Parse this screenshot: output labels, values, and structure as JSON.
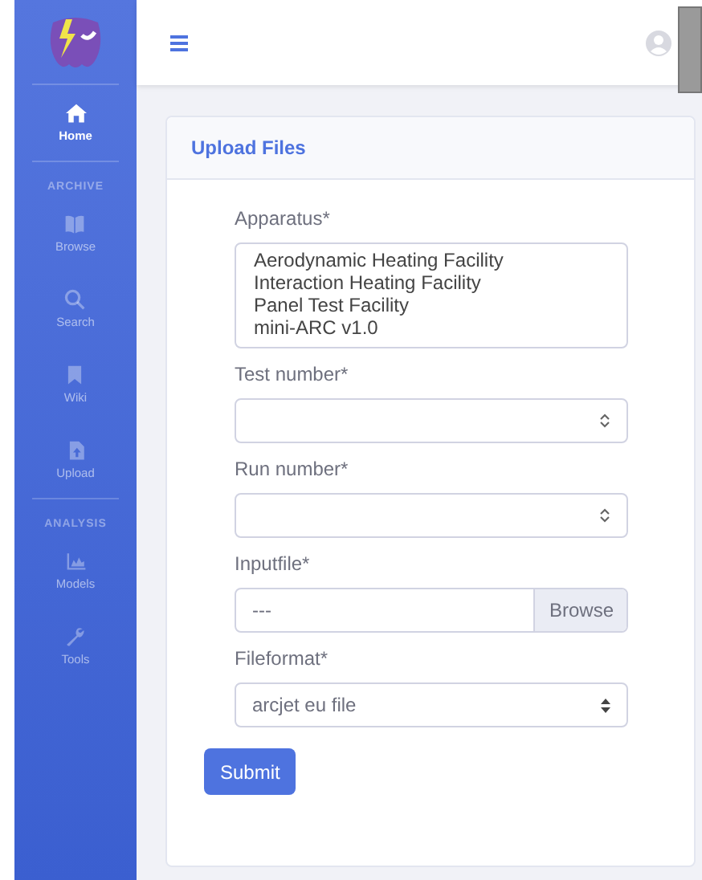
{
  "sidebar": {
    "items": [
      {
        "kind": "link",
        "label": "Home",
        "selected": true
      },
      {
        "kind": "heading",
        "label": "ARCHIVE"
      },
      {
        "kind": "link",
        "label": "Browse",
        "selected": false
      },
      {
        "kind": "link",
        "label": "Search",
        "selected": false
      },
      {
        "kind": "link",
        "label": "Wiki",
        "selected": false
      },
      {
        "kind": "link",
        "label": "Upload",
        "selected": false
      },
      {
        "kind": "heading",
        "label": "ANALYSIS"
      },
      {
        "kind": "link",
        "label": "Models",
        "selected": false
      },
      {
        "kind": "link",
        "label": "Tools",
        "selected": false
      }
    ]
  },
  "card": {
    "title": "Upload Files",
    "fields": [
      {
        "kind": "listbox",
        "label": "Apparatus*",
        "options": [
          "Aerodynamic Heating Facility",
          "Interaction Heating Facility",
          "Panel Test Facility",
          "mini-ARC v1.0"
        ]
      },
      {
        "kind": "number",
        "label": "Test number*"
      },
      {
        "kind": "number",
        "label": "Run number*"
      },
      {
        "kind": "file",
        "label": "Inputfile*",
        "value": "---",
        "button": "Browse"
      },
      {
        "kind": "select",
        "label": "Fileformat*",
        "value": "arcjet eu file"
      }
    ],
    "submit": "Submit"
  }
}
